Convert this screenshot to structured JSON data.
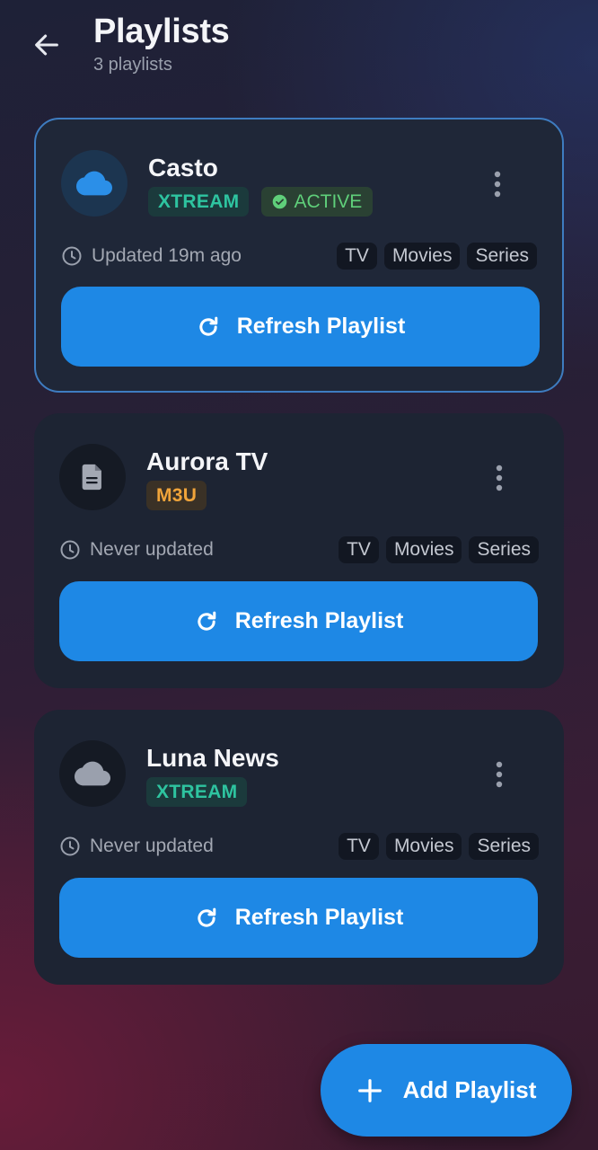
{
  "header": {
    "title": "Playlists",
    "subtitle": "3 playlists",
    "back_icon": "arrow-left-icon"
  },
  "playlists": [
    {
      "name": "Casto",
      "type": "XTREAM",
      "status": "ACTIVE",
      "icon": "cloud-icon",
      "updated": "Updated 19m ago",
      "content_types": [
        "TV",
        "Movies",
        "Series"
      ],
      "refresh_label": "Refresh Playlist",
      "active": true
    },
    {
      "name": "Aurora TV",
      "type": "M3U",
      "icon": "file-icon",
      "updated": "Never updated",
      "content_types": [
        "TV",
        "Movies",
        "Series"
      ],
      "refresh_label": "Refresh Playlist",
      "active": false
    },
    {
      "name": "Luna News",
      "type": "XTREAM",
      "icon": "cloud-icon",
      "updated": "Never updated",
      "content_types": [
        "TV",
        "Movies",
        "Series"
      ],
      "refresh_label": "Refresh Playlist",
      "active": false
    }
  ],
  "fab": {
    "label": "Add Playlist",
    "icon": "plus-icon"
  },
  "colors": {
    "accent": "#1e88e5",
    "xtream": "#2ec4a0",
    "m3u": "#f0a43a",
    "active": "#5fcf7a",
    "active_border": "#3e7cc0"
  }
}
